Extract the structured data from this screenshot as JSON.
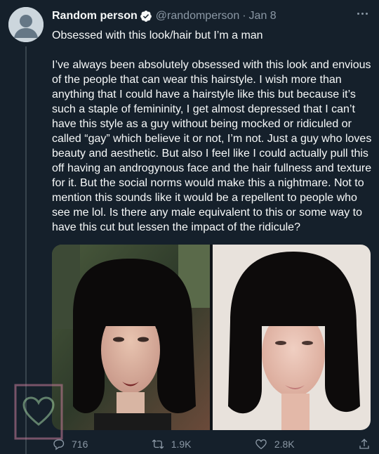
{
  "author": {
    "name": "Random person",
    "handle": "@randomperson",
    "separator": "·",
    "date": "Jan 8"
  },
  "tweet": {
    "text": "Obsessed with this look/hair but I’m a man\n\nI’ve always been absolutely obsessed with this look and envious of the people that can wear this hairstyle. I wish more than anything that I could have a hairstyle like this but because it’s such a staple of femininity, I get almost depressed that I can’t have this style as a guy without being mocked or ridiculed or called “gay” which believe it or not, I’m not. Just a guy who loves beauty and aesthetic. But also I feel like I could actually pull this off having an androgynous face and the hair fullness and texture for it. But the social norms would make this a nightmare. Not to mention this sounds like it would be a repellent to people who see me lol. Is there any male equivalent to this or some way to have this cut but lessen the impact of the ridicule?"
  },
  "actions": {
    "replies": "716",
    "retweets": "1.9K",
    "likes": "2.8K"
  },
  "colors": {
    "background": "#15202b",
    "text": "#f7f9f9",
    "secondary": "#8b98a5",
    "verified": "#1d9bf0"
  },
  "icons": {
    "verified": "verified-badge-icon",
    "more": "more-icon",
    "reply": "reply-icon",
    "retweet": "retweet-icon",
    "like": "like-icon",
    "share": "share-icon"
  }
}
